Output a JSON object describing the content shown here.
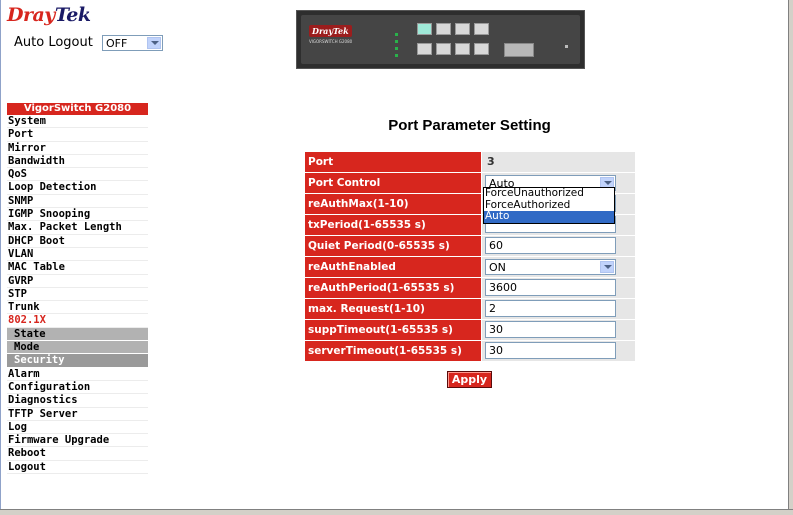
{
  "brand": {
    "part1": "Dray",
    "part2": "Tek"
  },
  "auto_logout": {
    "label": "Auto Logout",
    "value": "OFF"
  },
  "device_image": {
    "brand": "DrayTek",
    "model": "VIGORSWITCH G2080"
  },
  "menu": {
    "header": "VigorSwitch G2080",
    "items_top": [
      "System",
      "Port",
      "Mirror",
      "Bandwidth",
      "QoS",
      "Loop Detection",
      "SNMP",
      "IGMP Snooping",
      "Max. Packet Length",
      "DHCP Boot",
      "VLAN",
      "MAC Table",
      "GVRP",
      "STP",
      "Trunk"
    ],
    "active_group": "802.1X",
    "sub_items": [
      "State",
      "Mode",
      "Security"
    ],
    "items_bottom": [
      "Alarm",
      "Configuration",
      "Diagnostics",
      "TFTP Server",
      "Log",
      "Firmware Upgrade",
      "Reboot",
      "Logout"
    ]
  },
  "page": {
    "title": "Port Parameter Setting"
  },
  "form": {
    "port": {
      "label": "Port",
      "value": "3"
    },
    "port_control": {
      "label": "Port Control",
      "value": "Auto",
      "options": [
        "ForceUnauthorized",
        "ForceAuthorized",
        "Auto"
      ]
    },
    "reauth_max": {
      "label": "reAuthMax(1-10)",
      "value": ""
    },
    "tx_period": {
      "label": "txPeriod(1-65535 s)",
      "value": ""
    },
    "quiet_period": {
      "label": "Quiet Period(0-65535 s)",
      "value": "60"
    },
    "reauth_enabled": {
      "label": "reAuthEnabled",
      "value": "ON"
    },
    "reauth_period": {
      "label": "reAuthPeriod(1-65535 s)",
      "value": "3600"
    },
    "max_request": {
      "label": "max. Request(1-10)",
      "value": "2"
    },
    "supp_timeout": {
      "label": "suppTimeout(1-65535 s)",
      "value": "30"
    },
    "server_timeout": {
      "label": "serverTimeout(1-65535 s)",
      "value": "30"
    }
  },
  "apply_label": "Apply",
  "colors": {
    "accent": "#d7261e",
    "value_cell": "#e6e6e6",
    "selected_option": "#316ac5"
  }
}
